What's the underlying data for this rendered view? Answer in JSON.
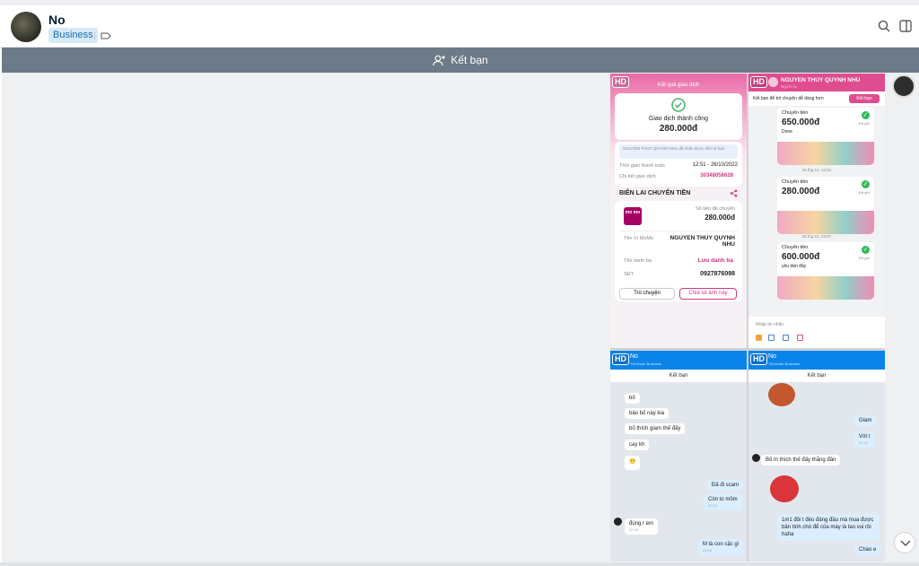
{
  "header": {
    "name": "No",
    "badge": "Business"
  },
  "add_friend_bar": {
    "label": "Kết bạn"
  },
  "screenshot": {
    "hd_label": "HD",
    "receipt": {
      "title": "Kết quả giao dịch",
      "status": "Giao dịch thành công",
      "amount": "280.000đ",
      "notice": "NGUYEN THUY QUYNH NHU đã nhận được tiền từ bạn",
      "time_label": "Thời gian thanh toán",
      "time_value": "12:51 - 26/10/2022",
      "detail_label": "Chi tiết giao dịch",
      "detail_value": "30348056628",
      "section_title": "BIÊN LAI CHUYỂN TIỀN",
      "logo_text": "mo mo",
      "sent_label": "Số tiền đã chuyển",
      "sent_value": "280.000đ",
      "wallet_label": "Tên Ví MoMo",
      "wallet_value": "NGUYEN THUY QUYNH NHU",
      "contact_label": "Tên danh bạ",
      "contact_value": "Lưu danh bạ",
      "phone_label": "SĐT",
      "phone_value": "0927876098",
      "btn_chat": "Trò chuyện",
      "btn_share": "Chia sẻ ảnh này"
    },
    "transfers": {
      "contact_name": "NGUYEN THUY QUYNH NHU",
      "contact_sub": "Người lạ",
      "hint": "Kết bạn để trò chuyện dễ dàng hơn",
      "add_btn": "Kết bạn",
      "items": [
        {
          "label": "Chuyển tiền",
          "amount": "650.000đ",
          "note": "Done",
          "status": "Đã gửi",
          "stamp": "26 thg 10, 12:51"
        },
        {
          "label": "Chuyển tiền",
          "amount": "280.000đ",
          "note": "",
          "status": "Đã gửi",
          "stamp": "26 thg 10, 23:57"
        },
        {
          "label": "Chuyển tiền",
          "amount": "600.000đ",
          "note": "yêu tâm đây",
          "status": "Đã gửi",
          "stamp": ""
        }
      ],
      "input_placeholder": "Nhập tin nhắn"
    },
    "chat_left": {
      "name": "No",
      "sub": "Tài khoản Business",
      "add_label": "Kết bạn",
      "messages": [
        {
          "text": "bố",
          "time": ""
        },
        {
          "text": "bảo bố này kia",
          "time": ""
        },
        {
          "text": "bố thích giam thế đấy",
          "time": ""
        },
        {
          "text": "cay kh",
          "time": ""
        },
        {
          "text": "Đã đi scam",
          "time": ""
        },
        {
          "text": "Còn to mồm",
          "time": "22:53"
        },
        {
          "text": "đúng r em",
          "time": "22:53"
        },
        {
          "text": "M là con cặc gì",
          "time": "22:53"
        }
      ]
    },
    "chat_right": {
      "name": "No",
      "sub": "Tài khoản Business",
      "add_label": "Kết bạn",
      "messages": [
        {
          "text": "Giam",
          "time": ""
        },
        {
          "text": "Với t",
          "time": "22:53"
        },
        {
          "text": "Bố m thích thế đấy thằng đần",
          "time": ""
        },
        {
          "text": "1m1 đồi t đéo đáng đầu mà mua được bản tính chó để của mày là tao vui rồi haha",
          "time": ""
        },
        {
          "text": "Chào e",
          "time": ""
        }
      ]
    }
  },
  "colors": {
    "add_bar": "#6d7a88",
    "badge_bg": "#d5eaf7",
    "momo_pink": "#e04c90",
    "zalo_blue": "#0a84e8"
  }
}
